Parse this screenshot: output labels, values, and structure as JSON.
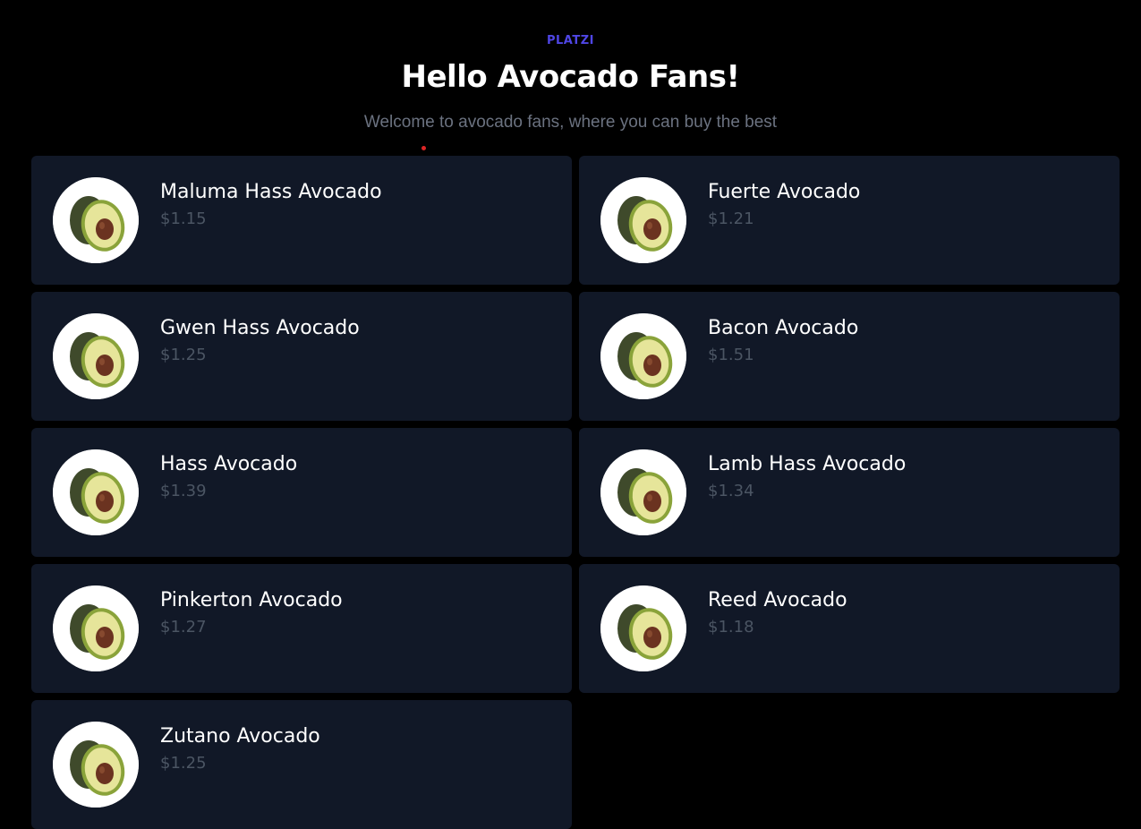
{
  "header": {
    "brand": "PLATZI",
    "title": "Hello Avocado Fans!",
    "subtitle": "Welcome to avocado fans, where you can buy the best"
  },
  "colors": {
    "background": "#000000",
    "card": "#111827",
    "brand": "#4f46e5",
    "price": "#4b5563",
    "subtitle": "#6b7280"
  },
  "products": [
    {
      "name": "Maluma Hass Avocado",
      "price": "$1.15",
      "icon": "avocado-image"
    },
    {
      "name": "Fuerte Avocado",
      "price": "$1.21",
      "icon": "avocado-image"
    },
    {
      "name": "Gwen Hass Avocado",
      "price": "$1.25",
      "icon": "avocado-image"
    },
    {
      "name": "Bacon Avocado",
      "price": "$1.51",
      "icon": "avocado-image"
    },
    {
      "name": "Hass Avocado",
      "price": "$1.39",
      "icon": "avocado-image"
    },
    {
      "name": "Lamb Hass Avocado",
      "price": "$1.34",
      "icon": "avocado-image"
    },
    {
      "name": "Pinkerton Avocado",
      "price": "$1.27",
      "icon": "avocado-image"
    },
    {
      "name": "Reed Avocado",
      "price": "$1.18",
      "icon": "avocado-image"
    },
    {
      "name": "Zutano Avocado",
      "price": "$1.25",
      "icon": "avocado-image"
    }
  ]
}
